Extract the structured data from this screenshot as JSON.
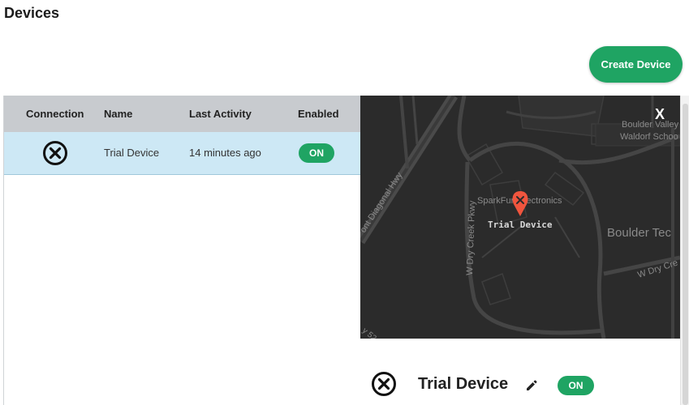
{
  "page": {
    "title": "Devices"
  },
  "toolbar": {
    "create_label": "Create Device"
  },
  "table": {
    "columns": [
      "Connection",
      "Name",
      "Last Activity",
      "Enabled"
    ],
    "rows": [
      {
        "connection": "disconnected-icon",
        "name": "Trial Device",
        "last_activity": "14 minutes ago",
        "enabled": "ON"
      }
    ]
  },
  "map": {
    "close_label": "X",
    "labels": {
      "diagonal_hwy": "ont Diagonal Hwy",
      "dry_creek_pkwy": "W Dry Creek Pkwy",
      "dry_creek_road": "W Dry Cre",
      "sparkfun": "SparkFun Electronics",
      "boulder_valley": "Boulder Valley",
      "waldorf": "Waldorf Schoo",
      "boulder_tech": "Boulder Tec",
      "device": "Trial Device",
      "hwy_52": "y 52"
    }
  },
  "detail": {
    "name": "Trial Device",
    "enabled": "ON"
  },
  "colors": {
    "accent": "#1fa463",
    "header": "#c8cbcf",
    "selected_row": "#cde8f5",
    "map_bg": "#2b2b2b",
    "marker": "#f0553e"
  }
}
